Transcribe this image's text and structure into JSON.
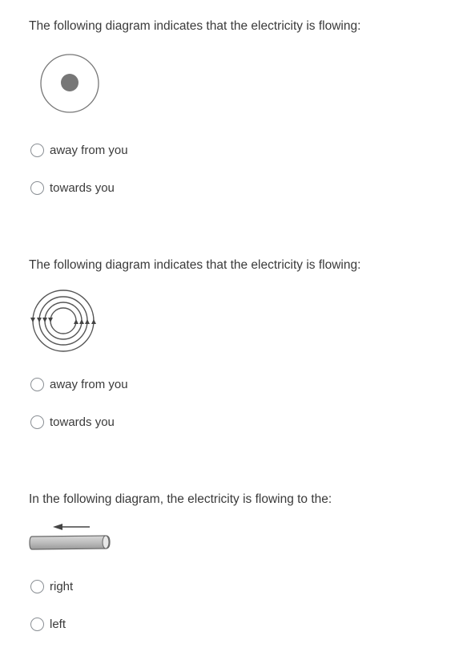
{
  "questions": [
    {
      "text": "The following diagram indicates that the electricity is flowing:",
      "diagram": "dot-in-circle (wire cross-section, current out of page)",
      "options": [
        "away from you",
        "towards you"
      ]
    },
    {
      "text": "The following diagram indicates that the electricity is flowing:",
      "diagram": "concentric-field-circles with arrows (down on left, up on right)",
      "options": [
        "away from you",
        "towards you"
      ]
    },
    {
      "text": "In the following diagram, the electricity is flowing to the:",
      "diagram": "cylindrical-wire with arrow pointing left",
      "options": [
        "right",
        "left"
      ]
    }
  ]
}
